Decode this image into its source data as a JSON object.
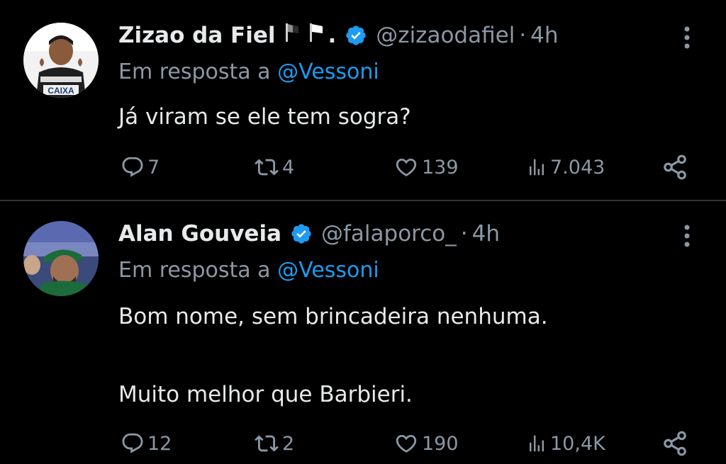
{
  "tweets": [
    {
      "name": "Zizao da Fiel",
      "name_suffix": ".",
      "handle": "@zizaodafiel",
      "dot": "·",
      "time": "4h",
      "reply_prefix": "Em resposta a",
      "reply_to": "@Vessoni",
      "text_lines": [
        "Já viram se ele tem sogra?"
      ],
      "avatar_text": "CAIXA",
      "stats": {
        "replies": "7",
        "retweets": "4",
        "likes": "139",
        "views": "7.043"
      }
    },
    {
      "name": "Alan Gouveia",
      "handle": "@falaporco_",
      "dot": "·",
      "time": "4h",
      "reply_prefix": "Em resposta a",
      "reply_to": "@Vessoni",
      "text_lines": [
        "Bom nome, sem brincadeira nenhuma.",
        "Muito melhor que Barbieri."
      ],
      "stats": {
        "replies": "12",
        "retweets": "2",
        "likes": "190",
        "views": "10,4K"
      }
    }
  ],
  "colors": {
    "background": "#000000",
    "text": "#e7e9ea",
    "secondary": "#8b98a5",
    "link": "#1d9bf0",
    "verified": "#1d9bf0",
    "divider": "#2f3336"
  },
  "icons": [
    "verified-badge-icon",
    "flag-icon",
    "more-options-icon",
    "reply-icon",
    "retweet-icon",
    "like-icon",
    "views-icon",
    "share-icon"
  ]
}
